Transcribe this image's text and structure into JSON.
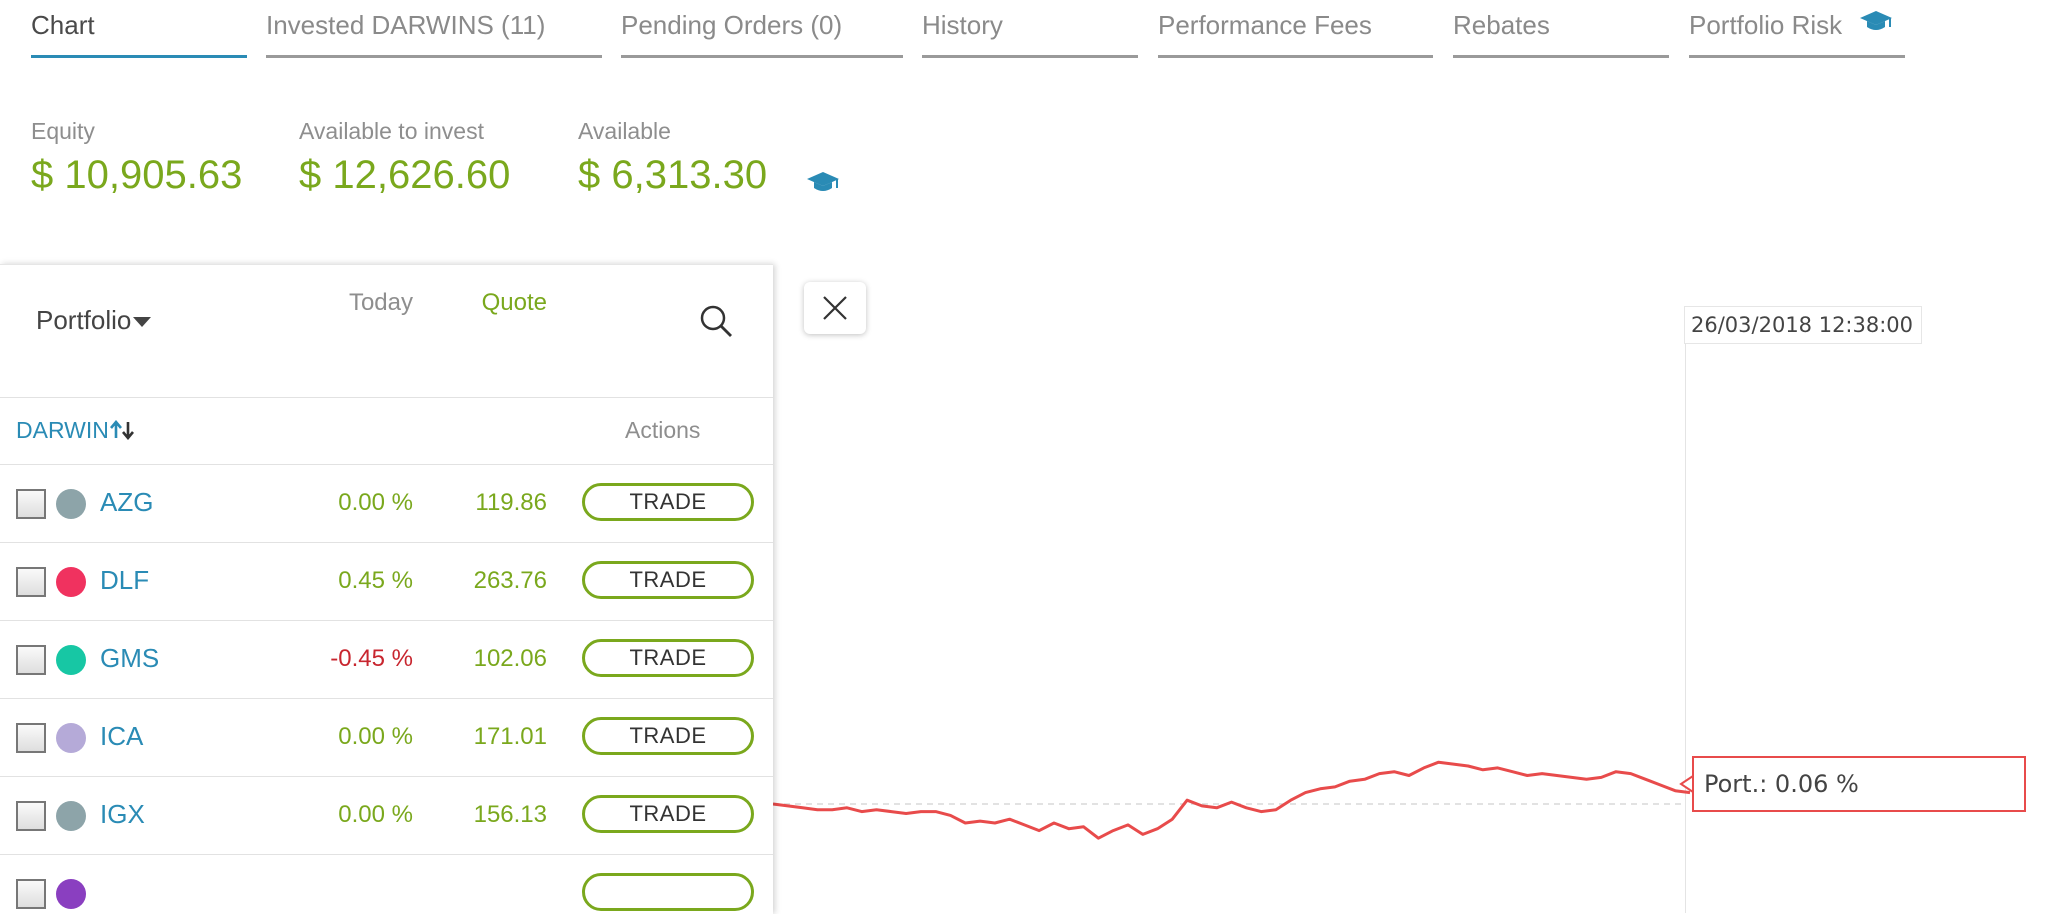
{
  "tabs": [
    {
      "label": "Chart"
    },
    {
      "label": "Invested DARWINS (11)"
    },
    {
      "label": "Pending Orders (0)"
    },
    {
      "label": "History"
    },
    {
      "label": "Performance Fees"
    },
    {
      "label": "Rebates"
    },
    {
      "label": "Portfolio Risk"
    }
  ],
  "balance": {
    "equity_label": "Equity",
    "equity_value": "$ 10,905.63",
    "available_invest_label": "Available to invest",
    "available_invest_value": "$ 12,626.60",
    "available_label": "Available",
    "available_value": "$ 6,313.30"
  },
  "panel": {
    "dropdown_label": "Portfolio",
    "columns": {
      "darwin": "DARWIN",
      "today": "Today",
      "quote": "Quote",
      "actions": "Actions"
    },
    "rows": [
      {
        "name": "AZG",
        "today": "0.00 %",
        "quote": "119.86",
        "action": "TRADE",
        "color": "#8da4a9",
        "trend": "pos"
      },
      {
        "name": "DLF",
        "today": "0.45 %",
        "quote": "263.76",
        "action": "TRADE",
        "color": "#f0325f",
        "trend": "pos"
      },
      {
        "name": "GMS",
        "today": "-0.45 %",
        "quote": "102.06",
        "action": "TRADE",
        "color": "#17c7a4",
        "trend": "neg"
      },
      {
        "name": "ICA",
        "today": "0.00 %",
        "quote": "171.01",
        "action": "TRADE",
        "color": "#b5aad8",
        "trend": "pos"
      },
      {
        "name": "IGX",
        "today": "0.00 %",
        "quote": "156.13",
        "action": "TRADE",
        "color": "#8da4a9",
        "trend": "pos"
      }
    ]
  },
  "chart": {
    "crosshair_date": "26/03/2018 12:38:00",
    "tooltip": "Port.: 0.06 %",
    "line_color": "#e84b4b"
  },
  "chart_data": {
    "type": "line",
    "series": [
      {
        "values": [
          0.0,
          -0.01,
          -0.02,
          -0.03,
          -0.03,
          -0.02,
          -0.04,
          -0.03,
          -0.04,
          -0.05,
          -0.04,
          -0.04,
          -0.06,
          -0.1,
          -0.09,
          -0.1,
          -0.08,
          -0.11,
          -0.14,
          -0.1,
          -0.13,
          -0.12,
          -0.18,
          -0.14,
          -0.11,
          -0.16,
          -0.13,
          -0.08,
          0.02,
          -0.01,
          -0.02,
          0.01,
          -0.02,
          -0.04,
          -0.03,
          0.02,
          0.06,
          0.08,
          0.09,
          0.12,
          0.13,
          0.16,
          0.17,
          0.15,
          0.19,
          0.22,
          0.21,
          0.2,
          0.18,
          0.19,
          0.17,
          0.15,
          0.16,
          0.15,
          0.14,
          0.13,
          0.14,
          0.17,
          0.16,
          0.13,
          0.1,
          0.07,
          0.06
        ]
      }
    ],
    "baseline": 0
  },
  "icons": {
    "cap": "graduation-cap-icon",
    "close": "close-icon",
    "search": "search-icon",
    "sort": "sort-icon",
    "caret": "caret-down-icon"
  }
}
